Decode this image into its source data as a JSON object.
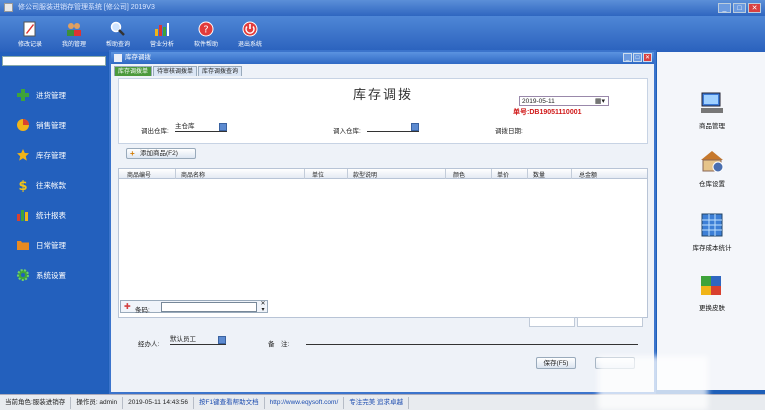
{
  "app": {
    "title": "修公司服装进销存管理系统 [修公司] 2019V3"
  },
  "toolbar": [
    {
      "label": "修改记录",
      "icon": "edit-icon"
    },
    {
      "label": "我的管理",
      "icon": "users-icon"
    },
    {
      "label": "帮助查询",
      "icon": "magnifier-icon"
    },
    {
      "label": "营业分析",
      "icon": "bar-chart-icon"
    },
    {
      "label": "软件帮助",
      "icon": "question-icon"
    },
    {
      "label": "退出系统",
      "icon": "power-icon"
    }
  ],
  "sidebar": {
    "items": [
      {
        "label": "进货管理",
        "icon": "plus-icon",
        "color": "#3ea33a"
      },
      {
        "label": "销售管理",
        "icon": "pie-chart-icon",
        "color": "#d8402f"
      },
      {
        "label": "库存管理",
        "icon": "star-icon",
        "color": "#f0b418"
      },
      {
        "label": "往来帐款",
        "icon": "dollar-icon",
        "color": "#f2c418"
      },
      {
        "label": "统计报表",
        "icon": "bar-chart-icon",
        "color": "#3ea33a"
      },
      {
        "label": "日常管理",
        "icon": "folder-icon",
        "color": "#e88a20"
      },
      {
        "label": "系统设置",
        "icon": "gear-icon",
        "color": "#3ea33a"
      }
    ]
  },
  "window": {
    "title": "库存调拨",
    "tabs": [
      "库存调拨单",
      "待审核调拨单",
      "库存调拨查询"
    ]
  },
  "form": {
    "heading": "库存调拨",
    "doc_no_label": "单号:",
    "doc_no": "DB19051110001",
    "out_warehouse_label": "调出仓库:",
    "out_warehouse_value": "主仓库",
    "in_warehouse_label": "调入仓库:",
    "in_warehouse_value": "",
    "date_label": "调拨日期:",
    "date_value": "2019-05-11",
    "add_button": "添加商品(F2)"
  },
  "grid": {
    "columns": [
      "商品编号",
      "商品名称",
      "单位",
      "款型说明",
      "颜色",
      "单价",
      "数量",
      "总金额"
    ]
  },
  "barcode": {
    "label": "条码:",
    "value": ""
  },
  "footer": {
    "handler_label": "经办人:",
    "handler_value": "默认员工",
    "note_label": "备　注:",
    "save_button": "保存(F5)"
  },
  "right_panel": [
    {
      "label": "商品管理",
      "icon": "computer-icon"
    },
    {
      "label": "仓库设置",
      "icon": "warehouse-icon"
    },
    {
      "label": "库存成本统计",
      "icon": "spreadsheet-icon"
    },
    {
      "label": "更换皮肤",
      "icon": "palette-icon"
    }
  ],
  "status": {
    "module": "当前角色:服装进销存",
    "operator": "操作员: admin",
    "datetime": "2019-05-11 14:43:56",
    "help": "按F1键查看帮助文档",
    "url": "http://www.eqysoft.com/",
    "slogan": "专注完美 追求卓越"
  }
}
